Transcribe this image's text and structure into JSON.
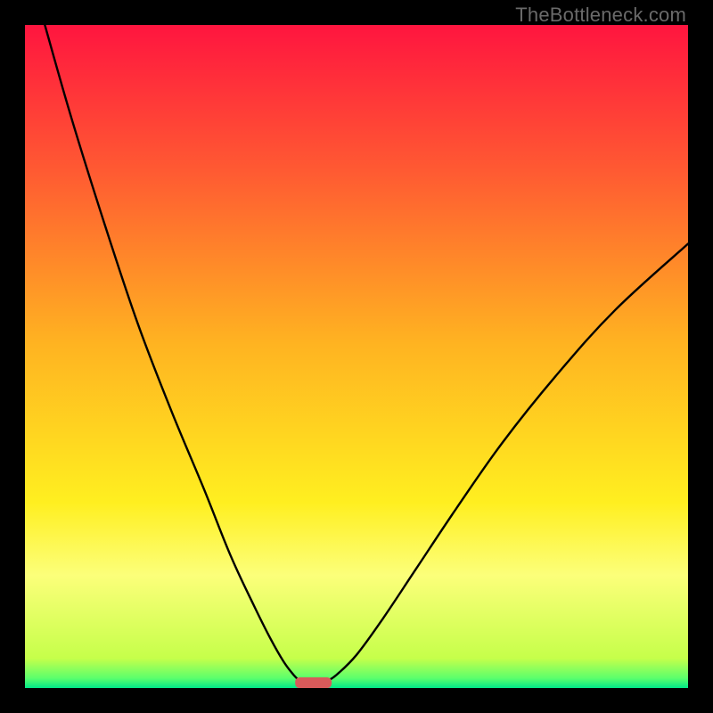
{
  "watermark": "TheBottleneck.com",
  "chart_data": {
    "type": "line",
    "title": "",
    "xlabel": "",
    "ylabel": "",
    "xlim": [
      0,
      100
    ],
    "ylim": [
      0,
      100
    ],
    "grid": false,
    "legend": false,
    "background_gradient_stops": [
      {
        "offset": 0.0,
        "color": "#ff153f"
      },
      {
        "offset": 0.22,
        "color": "#ff5a32"
      },
      {
        "offset": 0.48,
        "color": "#ffb321"
      },
      {
        "offset": 0.72,
        "color": "#ffef20"
      },
      {
        "offset": 0.83,
        "color": "#fcff7a"
      },
      {
        "offset": 0.955,
        "color": "#c6ff4a"
      },
      {
        "offset": 0.985,
        "color": "#5cff6c"
      },
      {
        "offset": 1.0,
        "color": "#00e888"
      }
    ],
    "series": [
      {
        "name": "left-branch",
        "x": [
          3.0,
          7.0,
          12.0,
          17.0,
          22.0,
          27.0,
          31.0,
          34.5,
          37.0,
          39.0,
          40.5,
          41.5
        ],
        "y": [
          100.0,
          86.0,
          70.0,
          55.0,
          42.0,
          30.0,
          20.0,
          12.5,
          7.5,
          4.0,
          2.0,
          1.0
        ]
      },
      {
        "name": "right-branch",
        "x": [
          45.5,
          47.0,
          50.0,
          54.0,
          59.0,
          65.0,
          72.0,
          80.0,
          89.0,
          100.0
        ],
        "y": [
          1.0,
          2.0,
          5.0,
          10.5,
          18.0,
          27.0,
          37.0,
          47.0,
          57.0,
          67.0
        ]
      }
    ],
    "marker": {
      "name": "minimum-marker",
      "x_center": 43.5,
      "y": 0.8,
      "width": 5.5,
      "color": "#d85a5a"
    }
  }
}
